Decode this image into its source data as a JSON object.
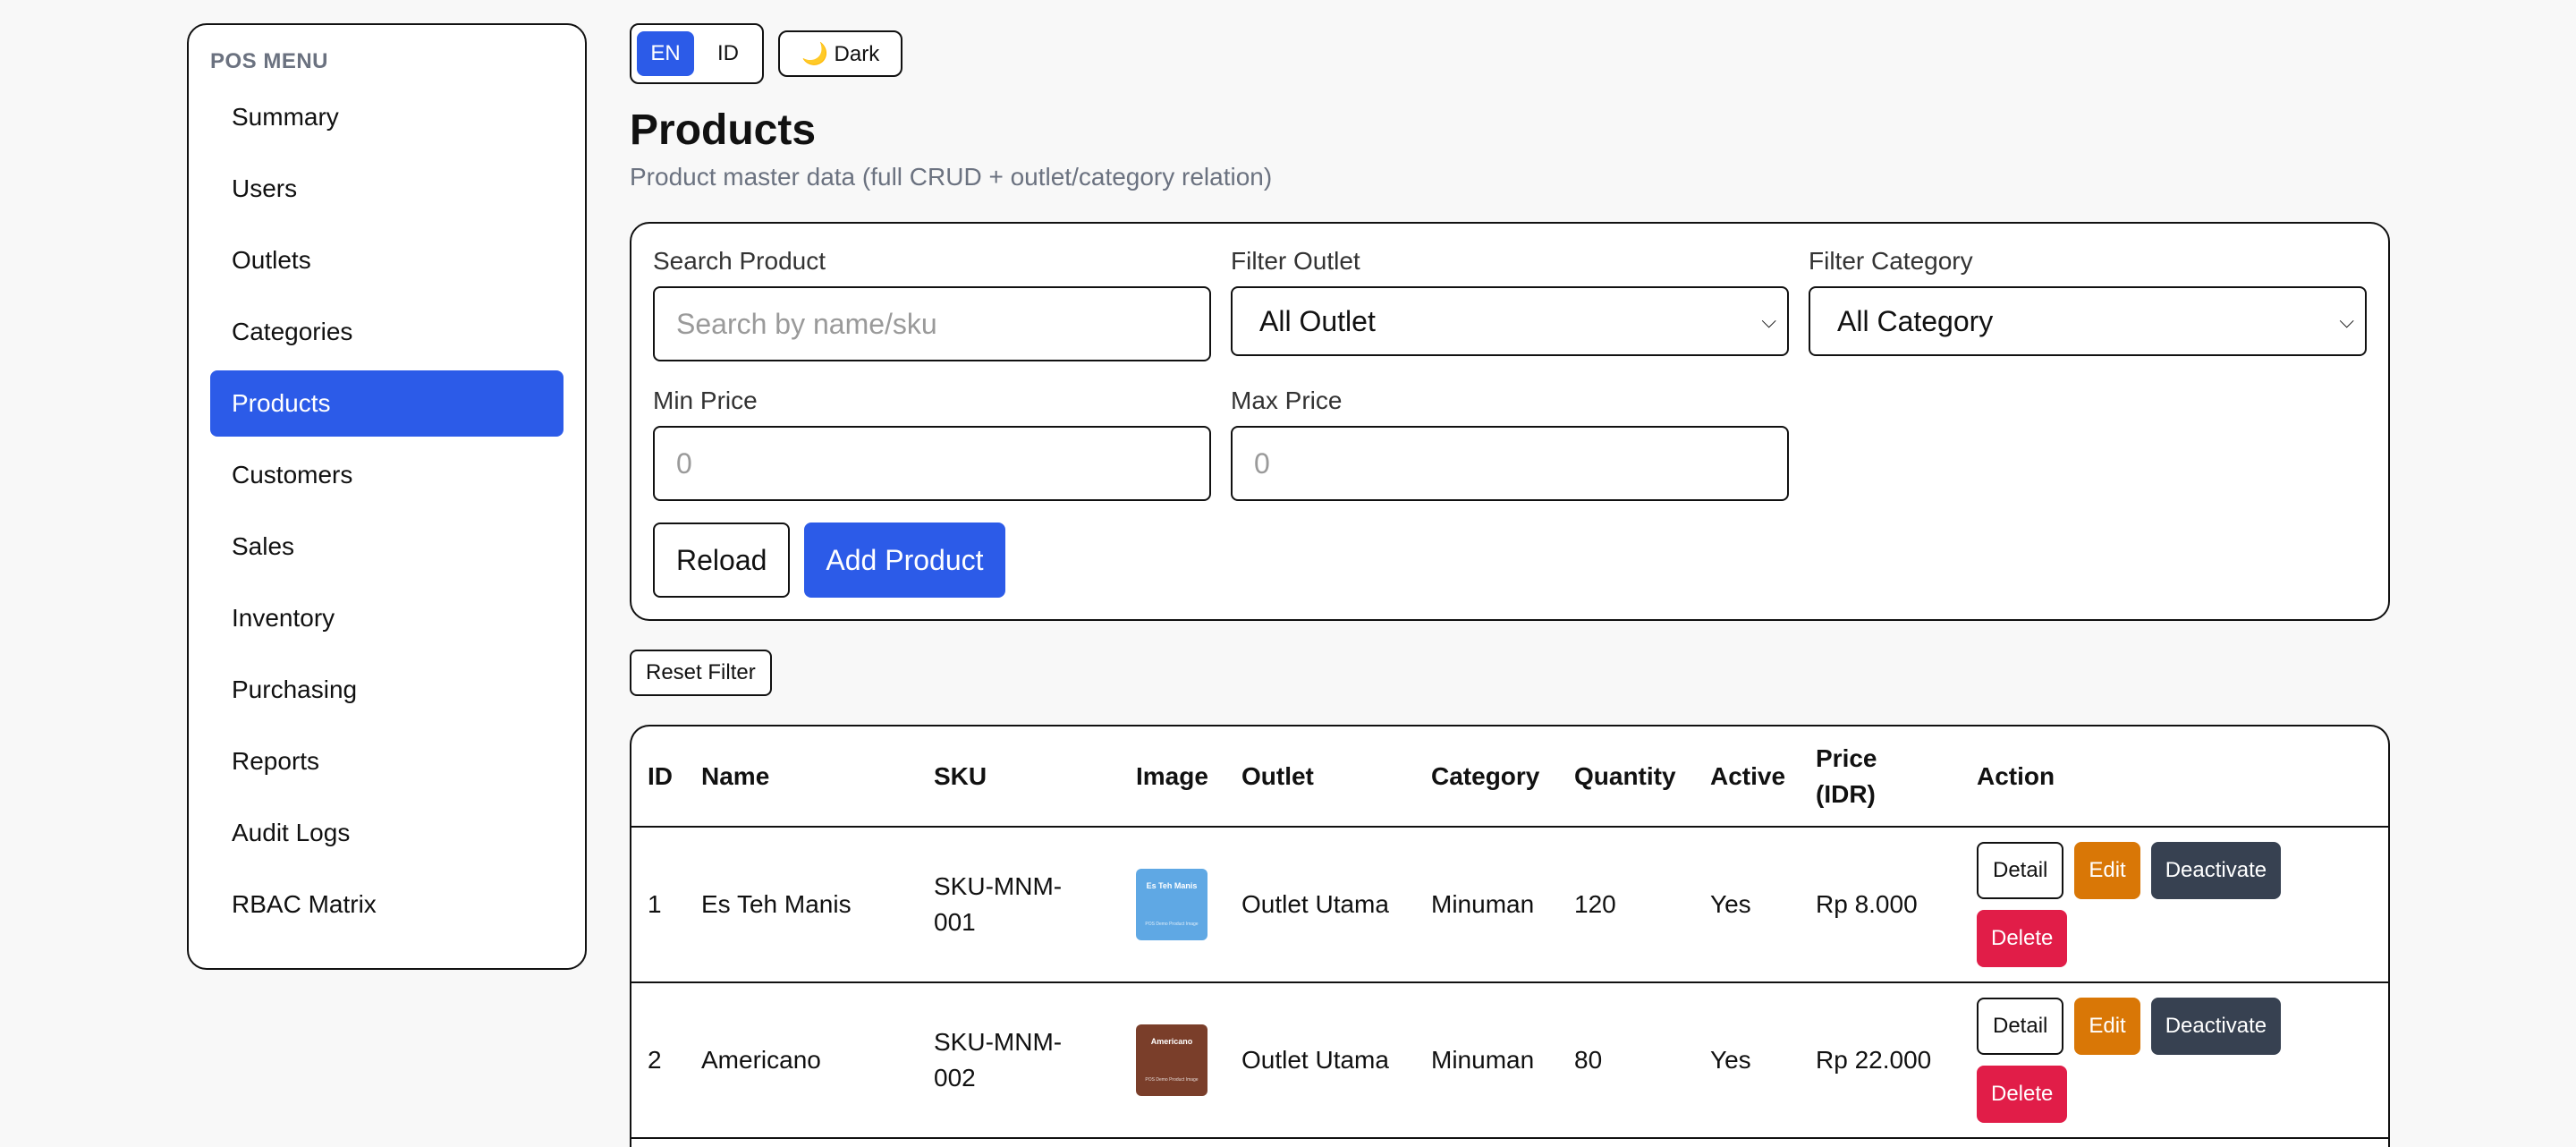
{
  "sidebar": {
    "title": "POS MENU",
    "items": [
      {
        "label": "Summary"
      },
      {
        "label": "Users"
      },
      {
        "label": "Outlets"
      },
      {
        "label": "Categories"
      },
      {
        "label": "Products"
      },
      {
        "label": "Customers"
      },
      {
        "label": "Sales"
      },
      {
        "label": "Inventory"
      },
      {
        "label": "Purchasing"
      },
      {
        "label": "Reports"
      },
      {
        "label": "Audit Logs"
      },
      {
        "label": "RBAC Matrix"
      }
    ],
    "active_index": 4
  },
  "top": {
    "lang_en": "EN",
    "lang_id": "ID",
    "theme_label": "🌙 Dark"
  },
  "page": {
    "title": "Products",
    "subtitle": "Product master data (full CRUD + outlet/category relation)"
  },
  "filters": {
    "search_label": "Search Product",
    "search_placeholder": "Search by name/sku",
    "outlet_label": "Filter Outlet",
    "outlet_value": "All Outlet",
    "category_label": "Filter Category",
    "category_value": "All Category",
    "min_label": "Min Price",
    "min_placeholder": "0",
    "max_label": "Max Price",
    "max_placeholder": "0",
    "reload_label": "Reload",
    "add_label": "Add Product",
    "reset_label": "Reset Filter"
  },
  "table": {
    "headers": {
      "id": "ID",
      "name": "Name",
      "sku": "SKU",
      "image": "Image",
      "outlet": "Outlet",
      "category": "Category",
      "quantity": "Quantity",
      "active": "Active",
      "price": "Price (IDR)",
      "action": "Action"
    },
    "actions": {
      "detail": "Detail",
      "edit": "Edit",
      "deactivate": "Deactivate",
      "delete": "Delete"
    },
    "rows": [
      {
        "id": "1",
        "name": "Es Teh Manis",
        "sku": "SKU-MNM-001",
        "img_title": "Es Teh Manis",
        "img_sub": "POS Demo Product Image",
        "img_color": "#5fa8e4",
        "outlet": "Outlet Utama",
        "category": "Minuman",
        "quantity": "120",
        "active": "Yes",
        "price": "Rp 8.000"
      },
      {
        "id": "2",
        "name": "Americano",
        "sku": "SKU-MNM-002",
        "img_title": "Americano",
        "img_sub": "POS Demo Product Image",
        "img_color": "#7a3e2a",
        "outlet": "Outlet Utama",
        "category": "Minuman",
        "quantity": "80",
        "active": "Yes",
        "price": "Rp 22.000"
      }
    ]
  }
}
